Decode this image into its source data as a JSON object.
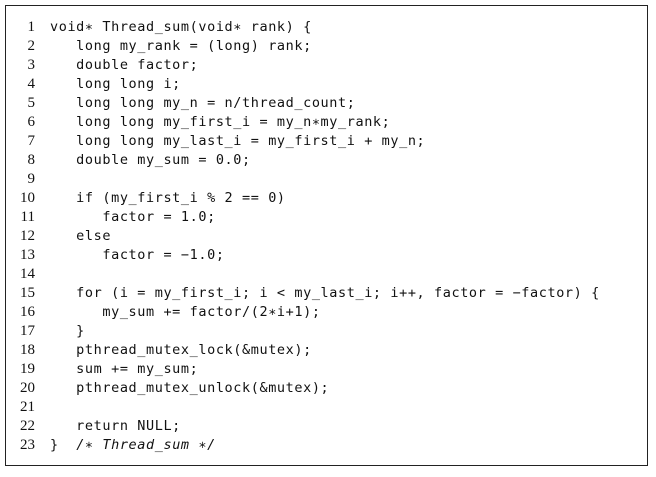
{
  "listing": {
    "lines": [
      {
        "n": "1",
        "code": "void∗ Thread_sum(void∗ rank) {"
      },
      {
        "n": "2",
        "code": "   long my_rank = (long) rank;"
      },
      {
        "n": "3",
        "code": "   double factor;"
      },
      {
        "n": "4",
        "code": "   long long i;"
      },
      {
        "n": "5",
        "code": "   long long my_n = n/thread_count;"
      },
      {
        "n": "6",
        "code": "   long long my_first_i = my_n∗my_rank;"
      },
      {
        "n": "7",
        "code": "   long long my_last_i = my_first_i + my_n;"
      },
      {
        "n": "8",
        "code": "   double my_sum = 0.0;"
      },
      {
        "n": "9",
        "code": ""
      },
      {
        "n": "10",
        "code": "   if (my_first_i % 2 == 0)"
      },
      {
        "n": "11",
        "code": "      factor = 1.0;"
      },
      {
        "n": "12",
        "code": "   else"
      },
      {
        "n": "13",
        "code": "      factor = −1.0;"
      },
      {
        "n": "14",
        "code": ""
      },
      {
        "n": "15",
        "code": "   for (i = my_first_i; i < my_last_i; i++, factor = −factor) {"
      },
      {
        "n": "16",
        "code": "      my_sum += factor/(2∗i+1);"
      },
      {
        "n": "17",
        "code": "   }"
      },
      {
        "n": "18",
        "code": "   pthread_mutex_lock(&mutex);"
      },
      {
        "n": "19",
        "code": "   sum += my_sum;"
      },
      {
        "n": "20",
        "code": "   pthread_mutex_unlock(&mutex);"
      },
      {
        "n": "21",
        "code": ""
      },
      {
        "n": "22",
        "code": "   return NULL;"
      },
      {
        "n": "23",
        "code": "}  /∗ Thread_sum ∗/"
      }
    ]
  }
}
